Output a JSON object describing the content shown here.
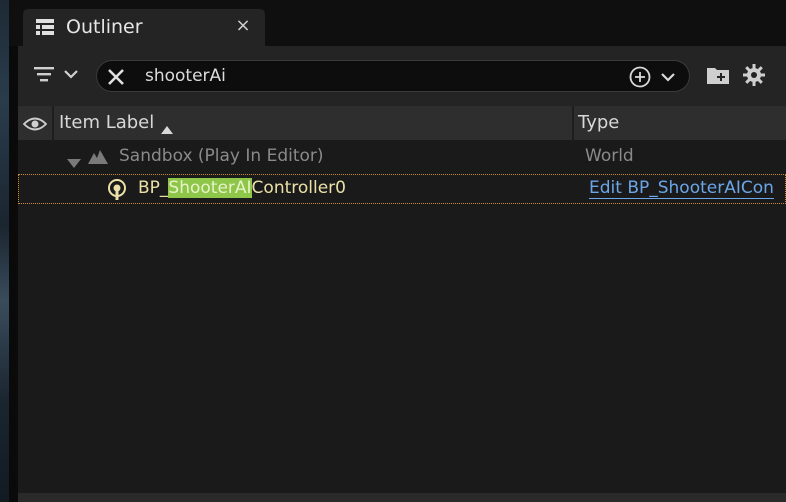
{
  "tab": {
    "title": "Outliner",
    "close_symbol": "×",
    "icon": "outliner-icon"
  },
  "toolbar": {
    "filter_icon": "filter-icon",
    "search": {
      "value": "shooterAi",
      "clear_icon": "close-icon",
      "add_icon": "add-circle-icon",
      "dropdown_icon": "chevron-down-icon"
    },
    "new_folder_icon": "folder-add-icon",
    "settings_icon": "gear-icon"
  },
  "header": {
    "visibility_icon": "eye-icon",
    "item_label": "Item Label",
    "sort_icon": "sort-ascending-icon",
    "type": "Type"
  },
  "rows": [
    {
      "label": "Sandbox (Play In Editor)",
      "type": "World",
      "icon": "world-icon",
      "expanded": true
    },
    {
      "label_prefix": "BP_",
      "label_match": "ShooterAI",
      "label_suffix": "Controller0",
      "type": "Edit BP_ShooterAICon",
      "icon": "ai-controller-icon",
      "selected": true
    }
  ],
  "colors": {
    "match_highlight": "#8dc648",
    "actor_text": "#ebe0a8",
    "link": "#6aa6e8",
    "selection_border": "#c98a30"
  }
}
